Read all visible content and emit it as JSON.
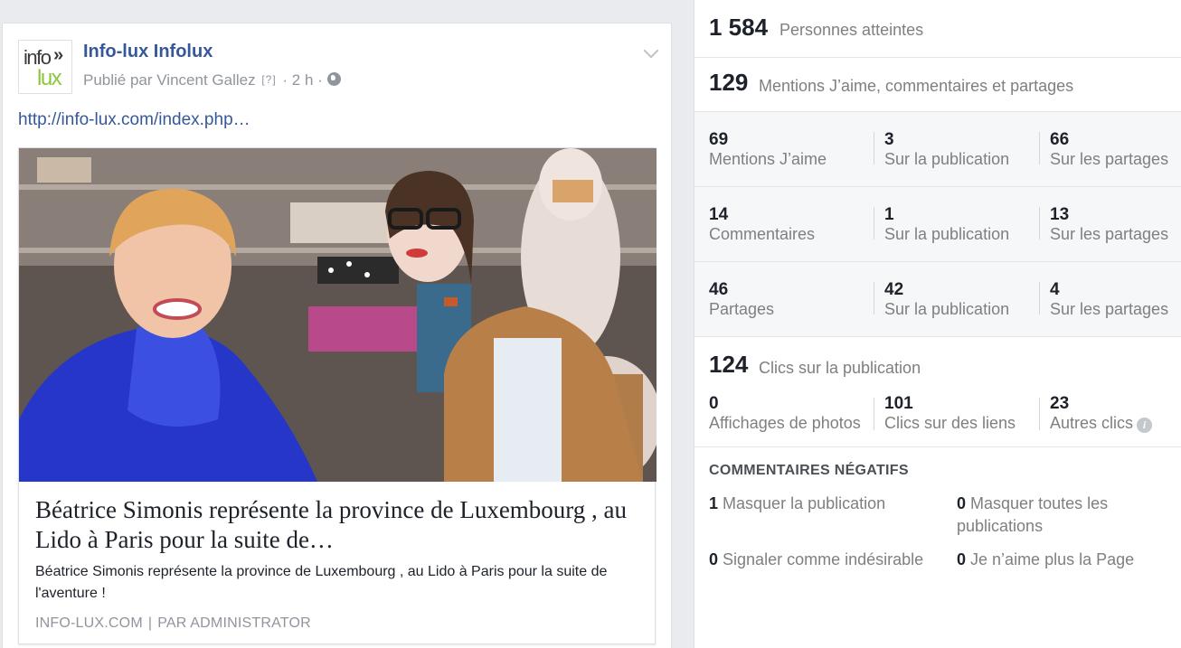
{
  "post": {
    "page_name": "Info-lux Infolux",
    "logo_top": "info",
    "logo_arrow": "»",
    "logo_bottom": "lux",
    "published_by": "Publié par Vincent Gallez",
    "help_marker": "[?]",
    "dot1": "·",
    "time": "2 h",
    "dot2": "·",
    "link_text": "http://info-lux.com/index.php…",
    "attachment": {
      "title": "Béatrice Simonis représente la province de Luxembourg , au Lido à Paris pour la suite de…",
      "description": "Béatrice Simonis représente la province de Luxembourg , au Lido à Paris pour la suite de l'aventure !",
      "source": "INFO-LUX.COM",
      "separator": "|",
      "author": "PAR ADMINISTRATOR"
    }
  },
  "insights": {
    "reach": {
      "value": "1 584",
      "label": "Personnes atteintes"
    },
    "engagement": {
      "value": "129",
      "label": "Mentions J’aime, commentaires et partages"
    },
    "rows": [
      {
        "cells": [
          {
            "value": "69",
            "label": "Mentions J’aime"
          },
          {
            "value": "3",
            "label": "Sur la publication"
          },
          {
            "value": "66",
            "label": "Sur les partages"
          }
        ]
      },
      {
        "cells": [
          {
            "value": "14",
            "label": "Commentaires"
          },
          {
            "value": "1",
            "label": "Sur la publication"
          },
          {
            "value": "13",
            "label": "Sur les partages"
          }
        ]
      },
      {
        "cells": [
          {
            "value": "46",
            "label": "Partages"
          },
          {
            "value": "42",
            "label": "Sur la publication"
          },
          {
            "value": "4",
            "label": "Sur les partages"
          }
        ]
      }
    ],
    "clicks": {
      "value": "124",
      "label": "Clics sur la publication"
    },
    "click_breakdown": [
      {
        "value": "0",
        "label": "Affichages de photos"
      },
      {
        "value": "101",
        "label": "Clics sur des liens"
      },
      {
        "value": "23",
        "label": "Autres clics"
      }
    ],
    "info_icon": "i",
    "negative": {
      "title": "COMMENTAIRES NÉGATIFS",
      "items": [
        {
          "value": "1",
          "label": "Masquer la publication"
        },
        {
          "value": "0",
          "label": "Masquer toutes les publications"
        },
        {
          "value": "0",
          "label": "Signaler comme indésirable"
        },
        {
          "value": "0",
          "label": "Je n’aime plus la Page"
        }
      ]
    }
  },
  "colors": {
    "link": "#365899",
    "muted": "#90949c",
    "label": "#7f7f7f"
  },
  "icons": [
    "chevron-down-icon",
    "globe-icon",
    "info-icon"
  ]
}
